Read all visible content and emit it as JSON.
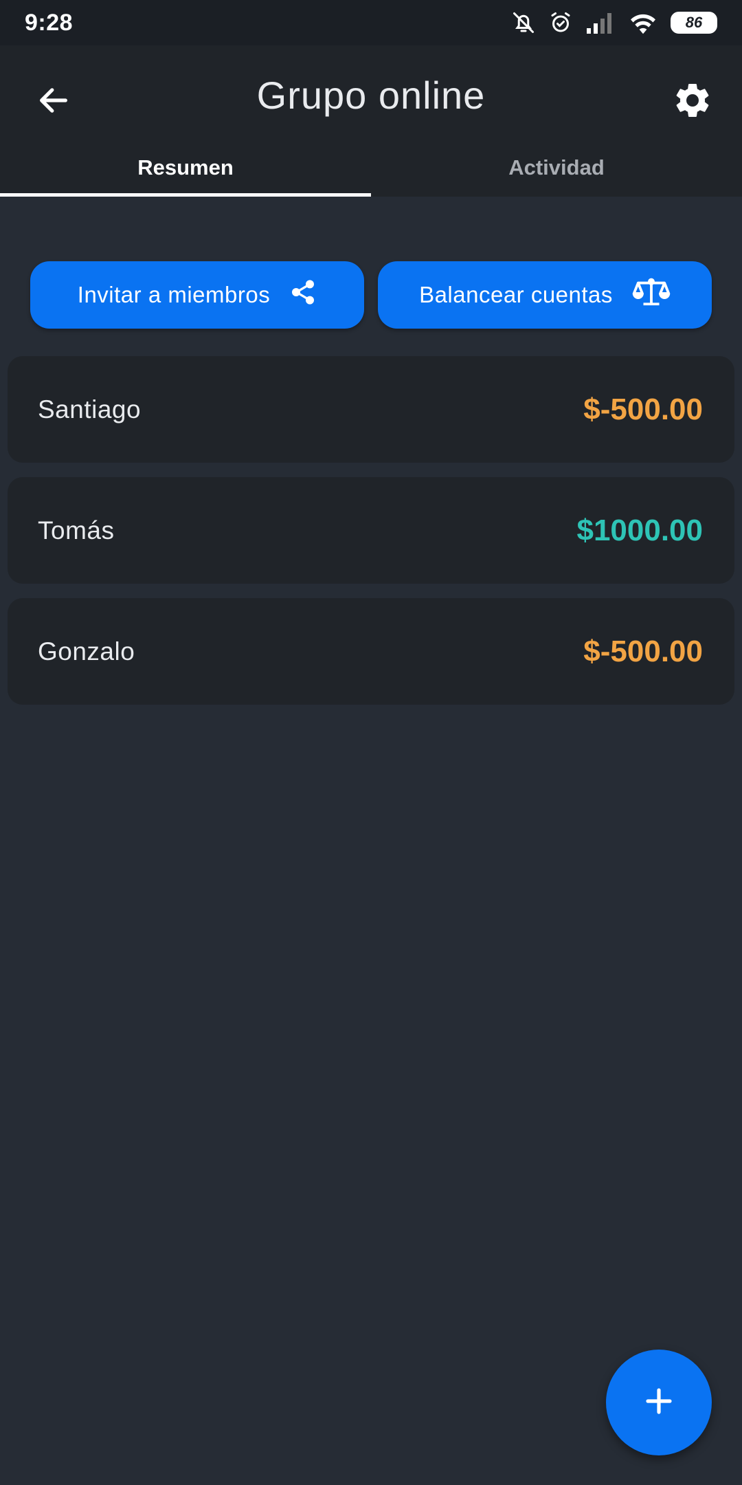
{
  "status_bar": {
    "time": "9:28",
    "battery": "86",
    "icons": [
      "bell-off-icon",
      "alarm-icon",
      "signal-icon",
      "wifi-icon",
      "battery-icon"
    ]
  },
  "header": {
    "title": "Grupo online",
    "back_icon": "arrow-left-icon",
    "settings_icon": "gear-icon"
  },
  "tabs": [
    {
      "label": "Resumen",
      "active": true
    },
    {
      "label": "Actividad",
      "active": false
    }
  ],
  "actions": {
    "invite_label": "Invitar a miembros",
    "invite_icon": "share-icon",
    "balance_label": "Balancear cuentas",
    "balance_icon": "scale-icon"
  },
  "members": [
    {
      "name": "Santiago",
      "amount": "$-500.00",
      "color": "#f2a444"
    },
    {
      "name": "Tomás",
      "amount": "$1000.00",
      "color": "#2ec4b6"
    },
    {
      "name": "Gonzalo",
      "amount": "$-500.00",
      "color": "#f2a444"
    }
  ],
  "fab": {
    "icon": "plus-icon"
  },
  "colors": {
    "accent": "#0a73f2",
    "negative": "#f2a444",
    "positive": "#2ec4b6",
    "background": "#262c35",
    "surface": "#202429"
  }
}
